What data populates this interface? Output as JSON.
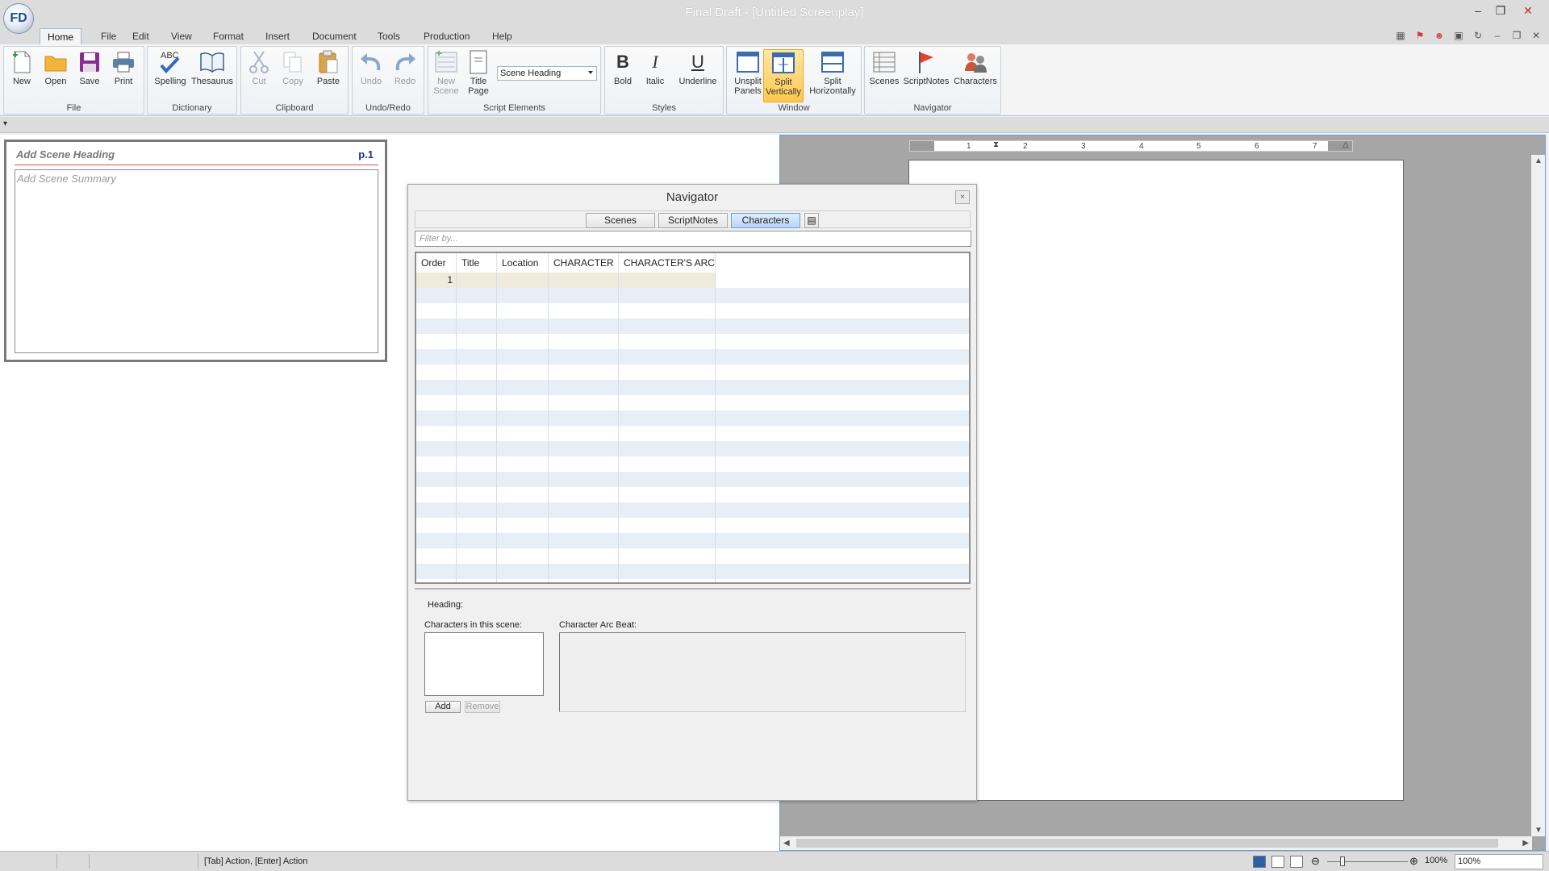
{
  "window": {
    "title": "Final Draft - [Untitled Screenplay]",
    "logo_text": "FD",
    "controls": [
      "minimize-icon",
      "restore-icon",
      "close-icon"
    ]
  },
  "menu": {
    "tabs": [
      "Home",
      "File",
      "Edit",
      "View",
      "Format",
      "Insert",
      "Document",
      "Tools",
      "Production",
      "Help"
    ],
    "active": "Home"
  },
  "ribbon": {
    "file": {
      "name": "File",
      "new": "New",
      "open": "Open",
      "save": "Save",
      "print": "Print"
    },
    "dictionary": {
      "name": "Dictionary",
      "spelling": "Spelling",
      "spelling_badge": "ABC",
      "thesaurus": "Thesaurus"
    },
    "clipboard": {
      "name": "Clipboard",
      "cut": "Cut",
      "copy": "Copy",
      "paste": "Paste"
    },
    "undoredo": {
      "name": "Undo/Redo",
      "undo": "Undo",
      "redo": "Redo"
    },
    "elements": {
      "name": "Script Elements",
      "new_scene_1": "New",
      "new_scene_2": "Scene",
      "title_page_1": "Title",
      "title_page_2": "Page",
      "element_value": "Scene Heading"
    },
    "styles": {
      "name": "Styles",
      "bold": "Bold",
      "bold_glyph": "B",
      "italic": "Italic",
      "italic_glyph": "I",
      "underline": "Underline",
      "underline_glyph": "U"
    },
    "window": {
      "name": "Window",
      "unsplit_1": "Unsplit",
      "unsplit_2": "Panels",
      "splitv_1": "Split",
      "splitv_2": "Vertically",
      "splith_1": "Split",
      "splith_2": "Horizontally"
    },
    "navigator": {
      "name": "Navigator",
      "scenes": "Scenes",
      "scriptnotes": "ScriptNotes",
      "characters": "Characters"
    }
  },
  "scene_card": {
    "heading": "Add Scene Heading",
    "page": "p.1",
    "summary": "Add Scene Summary"
  },
  "ruler": {
    "ticks": [
      "1",
      "2",
      "3",
      "4",
      "5",
      "6",
      "7"
    ]
  },
  "navigator": {
    "title": "Navigator",
    "close": "×",
    "tabs": [
      "Scenes",
      "ScriptNotes",
      "Characters"
    ],
    "active_tab": "Characters",
    "filter_placeholder": "Filter by...",
    "columns": [
      "Order",
      "Title",
      "Location",
      "CHARACTER",
      "CHARACTER'S ARC"
    ],
    "rows": [
      {
        "order": "1",
        "title": "",
        "location": "",
        "character": "",
        "arc": ""
      }
    ],
    "heading_label": "Heading:",
    "characters_label": "Characters in this scene:",
    "arc_beat_label": "Character Arc Beat:",
    "add_label": "Add",
    "remove_label": "Remove"
  },
  "status": {
    "hint": "[Tab]  Action,  [Enter] Action",
    "zoom_value": "100%",
    "zoom_select": "100%"
  },
  "colors": {
    "selected_button": "#ffc84d",
    "active_nav_tab": "#b9d5f5",
    "scene_rule": "#e54d4d",
    "page_number": "#1a2f8c"
  }
}
